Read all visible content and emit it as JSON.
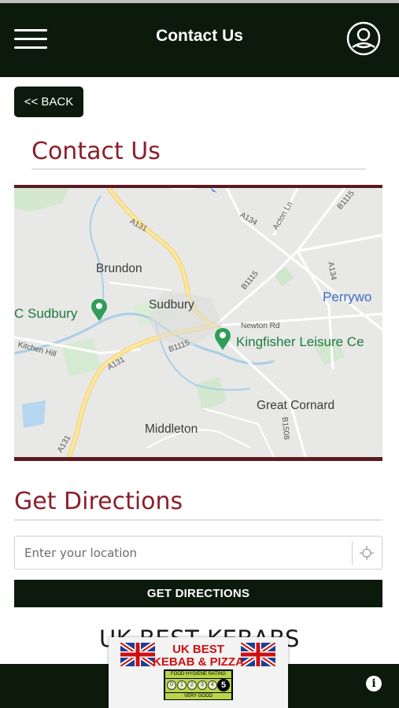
{
  "header": {
    "title": "Contact Us",
    "menu_icon": "hamburger-menu-icon",
    "account_icon": "user-account-icon",
    "background": "#0b1a0b"
  },
  "back_button": {
    "label": "<< BACK"
  },
  "contact_section": {
    "heading": "Contact Us",
    "heading_color": "#8b1f2a"
  },
  "map": {
    "places": [
      "Brundon",
      "Sudbury",
      "Middleton",
      "Great Cornard",
      "Perrywo"
    ],
    "pois": [
      "C Sudbury",
      "Kingfisher Leisure Ce"
    ],
    "roads": [
      "A131",
      "A131",
      "A131",
      "A134",
      "A134",
      "B1115",
      "B1115",
      "B1115",
      "B1508",
      "Newton Rd",
      "Acton Ln",
      "Kitchen Hill"
    ]
  },
  "directions_section": {
    "heading": "Get Directions",
    "input_placeholder": "Enter your location",
    "locate_icon": "crosshair-locate-icon",
    "button_label": "GET DIRECTIONS"
  },
  "restaurant_name": "UK BEST KEBABS",
  "badge": {
    "line1": "UK BEST",
    "line2": "KEBAB & PIZZA",
    "flag_icon": "union-jack-flag-icon",
    "hygiene_top": "FOOD HYGIENE RATING",
    "hygiene_scores": [
      "0",
      "1",
      "2",
      "3",
      "4"
    ],
    "hygiene_rating": "5",
    "hygiene_bottom": "VERY GOOD"
  },
  "footer": {
    "info_icon": "info-icon"
  }
}
